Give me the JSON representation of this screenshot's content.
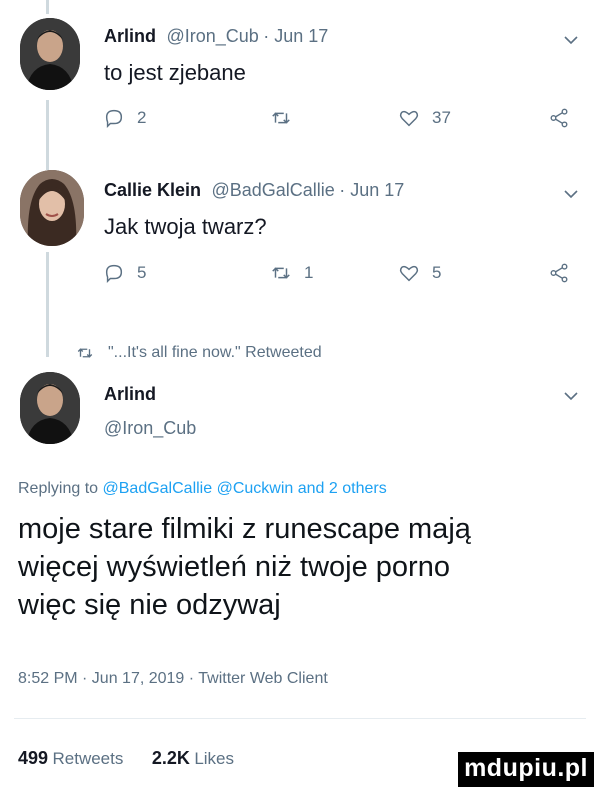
{
  "tweet1": {
    "name": "Arlind",
    "handle": "@Iron_Cub",
    "date": "Jun 17",
    "text": "to jest zjebane",
    "replies": "2",
    "retweets": "",
    "likes": "37"
  },
  "tweet2": {
    "name": "Callie Klein",
    "handle": "@BadGalCallie",
    "date": "Jun 17",
    "text": "Jak twoja twarz?",
    "replies": "5",
    "retweets": "1",
    "likes": "5"
  },
  "retweet_notice": "\"...It's all fine now.\" Retweeted",
  "main": {
    "name": "Arlind",
    "handle": "@Iron_Cub",
    "replying_prefix": "Replying to",
    "replying_mentions": "@BadGalCallie @Cuckwin",
    "replying_suffix": "and 2 others",
    "text_lines": [
      "moje stare filmiki z runescape mają",
      "więcej wyświetleń niż twoje porno",
      "więc się nie odzywaj"
    ],
    "timestamp": "8:52 PM · Jun 17, 2019 · Twitter Web Client",
    "retweets_count": "499",
    "retweets_label": "Retweets",
    "likes_count": "2.2K",
    "likes_label": "Likes"
  },
  "watermark": "mdupiu.pl",
  "colors": {
    "link": "#1da1f2",
    "muted": "#5b7083",
    "thread_line": "#cfd9de"
  }
}
